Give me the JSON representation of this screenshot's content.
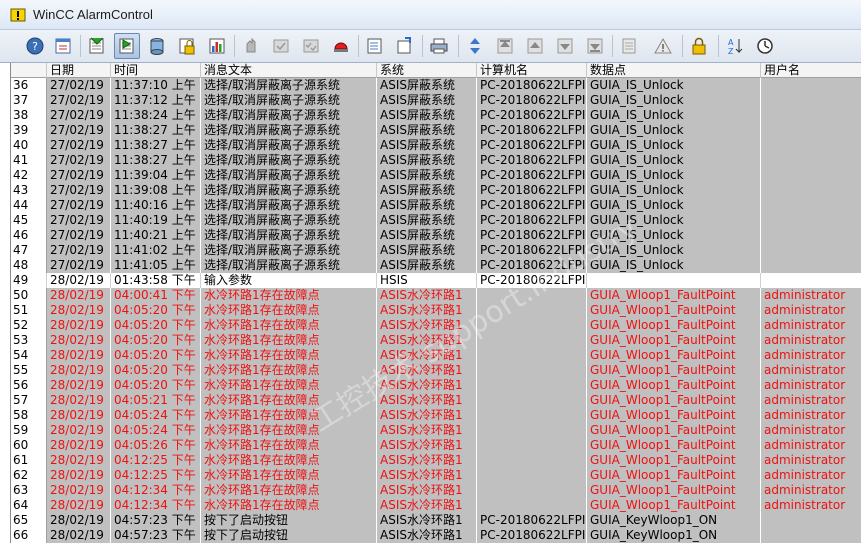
{
  "window": {
    "title": "WinCC AlarmControl"
  },
  "toolbar": {
    "buttons": [
      {
        "name": "help-icon"
      },
      {
        "name": "config-dialog-icon"
      },
      {
        "name": "message-list-icon"
      },
      {
        "name": "short-term-archive-icon",
        "pressed": true
      },
      {
        "name": "long-term-archive-icon"
      },
      {
        "name": "lock-list-icon"
      },
      {
        "name": "statistics-icon"
      },
      {
        "name": "ack-central-icon"
      },
      {
        "name": "single-ack-icon"
      },
      {
        "name": "group-ack-icon"
      },
      {
        "name": "emergency-ack-icon"
      },
      {
        "name": "selection-dialog-icon"
      },
      {
        "name": "display-options-icon"
      },
      {
        "name": "print-icon"
      },
      {
        "name": "sort-icon"
      },
      {
        "name": "first-message-icon"
      },
      {
        "name": "previous-message-icon"
      },
      {
        "name": "next-message-icon"
      },
      {
        "name": "last-message-icon"
      },
      {
        "name": "info-text-icon"
      },
      {
        "name": "comment-icon"
      },
      {
        "name": "lock-icon"
      },
      {
        "name": "sort-dialog-icon"
      },
      {
        "name": "time-base-icon"
      }
    ]
  },
  "table": {
    "headers": [
      "日期",
      "时间",
      "消息文本",
      "系统",
      "计算机名",
      "数据点",
      "用户名"
    ],
    "rows": [
      {
        "n": "36",
        "date": "27/02/19",
        "time": "11:37:10 上午",
        "text": "选择/取消屏蔽离子源系统",
        "sys": "ASIS屏蔽系统",
        "pc": "PC-20180622LFPI",
        "tag": "GUIA_IS_Unlock",
        "user": "",
        "style": "gray"
      },
      {
        "n": "37",
        "date": "27/02/19",
        "time": "11:37:12 上午",
        "text": "选择/取消屏蔽离子源系统",
        "sys": "ASIS屏蔽系统",
        "pc": "PC-20180622LFPI",
        "tag": "GUIA_IS_Unlock",
        "user": "",
        "style": "gray"
      },
      {
        "n": "38",
        "date": "27/02/19",
        "time": "11:38:24 上午",
        "text": "选择/取消屏蔽离子源系统",
        "sys": "ASIS屏蔽系统",
        "pc": "PC-20180622LFPI",
        "tag": "GUIA_IS_Unlock",
        "user": "",
        "style": "gray"
      },
      {
        "n": "39",
        "date": "27/02/19",
        "time": "11:38:27 上午",
        "text": "选择/取消屏蔽离子源系统",
        "sys": "ASIS屏蔽系统",
        "pc": "PC-20180622LFPI",
        "tag": "GUIA_IS_Unlock",
        "user": "",
        "style": "gray"
      },
      {
        "n": "40",
        "date": "27/02/19",
        "time": "11:38:27 上午",
        "text": "选择/取消屏蔽离子源系统",
        "sys": "ASIS屏蔽系统",
        "pc": "PC-20180622LFPI",
        "tag": "GUIA_IS_Unlock",
        "user": "",
        "style": "gray"
      },
      {
        "n": "41",
        "date": "27/02/19",
        "time": "11:38:27 上午",
        "text": "选择/取消屏蔽离子源系统",
        "sys": "ASIS屏蔽系统",
        "pc": "PC-20180622LFPI",
        "tag": "GUIA_IS_Unlock",
        "user": "",
        "style": "gray"
      },
      {
        "n": "42",
        "date": "27/02/19",
        "time": "11:39:04 上午",
        "text": "选择/取消屏蔽离子源系统",
        "sys": "ASIS屏蔽系统",
        "pc": "PC-20180622LFPI",
        "tag": "GUIA_IS_Unlock",
        "user": "",
        "style": "gray"
      },
      {
        "n": "43",
        "date": "27/02/19",
        "time": "11:39:08 上午",
        "text": "选择/取消屏蔽离子源系统",
        "sys": "ASIS屏蔽系统",
        "pc": "PC-20180622LFPI",
        "tag": "GUIA_IS_Unlock",
        "user": "",
        "style": "gray"
      },
      {
        "n": "44",
        "date": "27/02/19",
        "time": "11:40:16 上午",
        "text": "选择/取消屏蔽离子源系统",
        "sys": "ASIS屏蔽系统",
        "pc": "PC-20180622LFPI",
        "tag": "GUIA_IS_Unlock",
        "user": "",
        "style": "gray"
      },
      {
        "n": "45",
        "date": "27/02/19",
        "time": "11:40:19 上午",
        "text": "选择/取消屏蔽离子源系统",
        "sys": "ASIS屏蔽系统",
        "pc": "PC-20180622LFPI",
        "tag": "GUIA_IS_Unlock",
        "user": "",
        "style": "gray"
      },
      {
        "n": "46",
        "date": "27/02/19",
        "time": "11:40:21 上午",
        "text": "选择/取消屏蔽离子源系统",
        "sys": "ASIS屏蔽系统",
        "pc": "PC-20180622LFPI",
        "tag": "GUIA_IS_Unlock",
        "user": "",
        "style": "gray"
      },
      {
        "n": "47",
        "date": "27/02/19",
        "time": "11:41:02 上午",
        "text": "选择/取消屏蔽离子源系统",
        "sys": "ASIS屏蔽系统",
        "pc": "PC-20180622LFPI",
        "tag": "GUIA_IS_Unlock",
        "user": "",
        "style": "gray"
      },
      {
        "n": "48",
        "date": "27/02/19",
        "time": "11:41:05 上午",
        "text": "选择/取消屏蔽离子源系统",
        "sys": "ASIS屏蔽系统",
        "pc": "PC-20180622LFPI",
        "tag": "GUIA_IS_Unlock",
        "user": "",
        "style": "gray"
      },
      {
        "n": "49",
        "date": "28/02/19",
        "time": "01:43:58 下午",
        "text": "输入参数",
        "sys": "HSIS",
        "pc": "PC-20180622LFPI",
        "tag": "",
        "user": "",
        "style": "white"
      },
      {
        "n": "50",
        "date": "28/02/19",
        "time": "04:00:41 下午",
        "text": "水冷环路1存在故障点",
        "sys": "ASIS水冷环路1",
        "pc": "",
        "tag": "GUIA_Wloop1_FaultPoint",
        "user": "administrator",
        "style": "alarm"
      },
      {
        "n": "51",
        "date": "28/02/19",
        "time": "04:05:20 下午",
        "text": "水冷环路1存在故障点",
        "sys": "ASIS水冷环路1",
        "pc": "",
        "tag": "GUIA_Wloop1_FaultPoint",
        "user": "administrator",
        "style": "alarm"
      },
      {
        "n": "52",
        "date": "28/02/19",
        "time": "04:05:20 下午",
        "text": "水冷环路1存在故障点",
        "sys": "ASIS水冷环路1",
        "pc": "",
        "tag": "GUIA_Wloop1_FaultPoint",
        "user": "administrator",
        "style": "alarm"
      },
      {
        "n": "53",
        "date": "28/02/19",
        "time": "04:05:20 下午",
        "text": "水冷环路1存在故障点",
        "sys": "ASIS水冷环路1",
        "pc": "",
        "tag": "GUIA_Wloop1_FaultPoint",
        "user": "administrator",
        "style": "alarm"
      },
      {
        "n": "54",
        "date": "28/02/19",
        "time": "04:05:20 下午",
        "text": "水冷环路1存在故障点",
        "sys": "ASIS水冷环路1",
        "pc": "",
        "tag": "GUIA_Wloop1_FaultPoint",
        "user": "administrator",
        "style": "alarm"
      },
      {
        "n": "55",
        "date": "28/02/19",
        "time": "04:05:20 下午",
        "text": "水冷环路1存在故障点",
        "sys": "ASIS水冷环路1",
        "pc": "",
        "tag": "GUIA_Wloop1_FaultPoint",
        "user": "administrator",
        "style": "alarm"
      },
      {
        "n": "56",
        "date": "28/02/19",
        "time": "04:05:20 下午",
        "text": "水冷环路1存在故障点",
        "sys": "ASIS水冷环路1",
        "pc": "",
        "tag": "GUIA_Wloop1_FaultPoint",
        "user": "administrator",
        "style": "alarm"
      },
      {
        "n": "57",
        "date": "28/02/19",
        "time": "04:05:21 下午",
        "text": "水冷环路1存在故障点",
        "sys": "ASIS水冷环路1",
        "pc": "",
        "tag": "GUIA_Wloop1_FaultPoint",
        "user": "administrator",
        "style": "alarm"
      },
      {
        "n": "58",
        "date": "28/02/19",
        "time": "04:05:24 下午",
        "text": "水冷环路1存在故障点",
        "sys": "ASIS水冷环路1",
        "pc": "",
        "tag": "GUIA_Wloop1_FaultPoint",
        "user": "administrator",
        "style": "alarm"
      },
      {
        "n": "59",
        "date": "28/02/19",
        "time": "04:05:24 下午",
        "text": "水冷环路1存在故障点",
        "sys": "ASIS水冷环路1",
        "pc": "",
        "tag": "GUIA_Wloop1_FaultPoint",
        "user": "administrator",
        "style": "alarm"
      },
      {
        "n": "60",
        "date": "28/02/19",
        "time": "04:05:26 下午",
        "text": "水冷环路1存在故障点",
        "sys": "ASIS水冷环路1",
        "pc": "",
        "tag": "GUIA_Wloop1_FaultPoint",
        "user": "administrator",
        "style": "alarm"
      },
      {
        "n": "61",
        "date": "28/02/19",
        "time": "04:12:25 下午",
        "text": "水冷环路1存在故障点",
        "sys": "ASIS水冷环路1",
        "pc": "",
        "tag": "GUIA_Wloop1_FaultPoint",
        "user": "administrator",
        "style": "alarm"
      },
      {
        "n": "62",
        "date": "28/02/19",
        "time": "04:12:25 下午",
        "text": "水冷环路1存在故障点",
        "sys": "ASIS水冷环路1",
        "pc": "",
        "tag": "GUIA_Wloop1_FaultPoint",
        "user": "administrator",
        "style": "alarm"
      },
      {
        "n": "63",
        "date": "28/02/19",
        "time": "04:12:34 下午",
        "text": "水冷环路1存在故障点",
        "sys": "ASIS水冷环路1",
        "pc": "",
        "tag": "GUIA_Wloop1_FaultPoint",
        "user": "administrator",
        "style": "alarm"
      },
      {
        "n": "64",
        "date": "28/02/19",
        "time": "04:12:34 下午",
        "text": "水冷环路1存在故障点",
        "sys": "ASIS水冷环路1",
        "pc": "",
        "tag": "GUIA_Wloop1_FaultPoint",
        "user": "administrator",
        "style": "alarm"
      },
      {
        "n": "65",
        "date": "28/02/19",
        "time": "04:57:23 下午",
        "text": "按下了启动按钮",
        "sys": "ASIS水冷环路1",
        "pc": "PC-20180622LFPI",
        "tag": "GUIA_KeyWloop1_ON",
        "user": "",
        "style": "gray"
      },
      {
        "n": "66",
        "date": "28/02/19",
        "time": "04:57:23 下午",
        "text": "按下了启动按钮",
        "sys": "ASIS水冷环路1",
        "pc": "PC-20180622LFPI",
        "tag": "GUIA_KeyWloop1_ON",
        "user": "",
        "style": "gray"
      }
    ]
  },
  "colors": {
    "alarm_text": "#ee1111",
    "row_gray": "#c0c0c0",
    "row_white": "#ffffff"
  }
}
